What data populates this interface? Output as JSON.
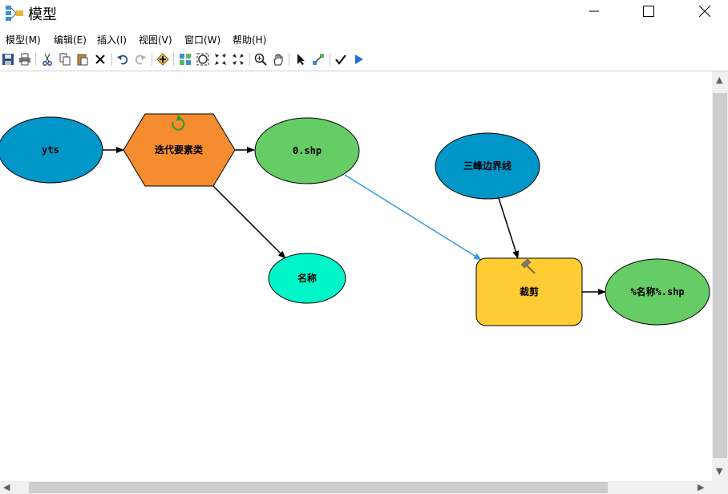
{
  "window": {
    "title": "模型"
  },
  "menu": [
    "模型(M)",
    "编辑(E)",
    "插入(I)",
    "视图(V)",
    "窗口(W)",
    "帮助(H)"
  ],
  "toolbar": {
    "buttons": [
      "save-icon",
      "print-icon",
      "cut-icon",
      "copy-icon",
      "paste-icon",
      "delete-icon",
      "undo-icon",
      "redo-icon",
      "add-data-icon",
      "auto-layout-icon",
      "full-extent-icon",
      "zoom-in-fixed-icon",
      "zoom-out-fixed-icon",
      "zoom-in-icon",
      "pan-icon",
      "select-icon",
      "connect-icon",
      "validate-icon",
      "run-icon"
    ]
  },
  "model": {
    "nodes": {
      "yts": "yts",
      "iterator": "迭代要素类",
      "out_shp": "0.shp",
      "boundary": "三峰边界线",
      "name": "名称",
      "clip": "裁剪",
      "clip_output": "%名称%.shp"
    },
    "colors": {
      "input_data": "#0096C8",
      "iterator": "#F58C2F",
      "derived_data": "#66CC66",
      "value": "#00F5C8",
      "tool": "#FFCC33",
      "link": "#000000",
      "precondition_link": "#2E9BE8"
    }
  }
}
